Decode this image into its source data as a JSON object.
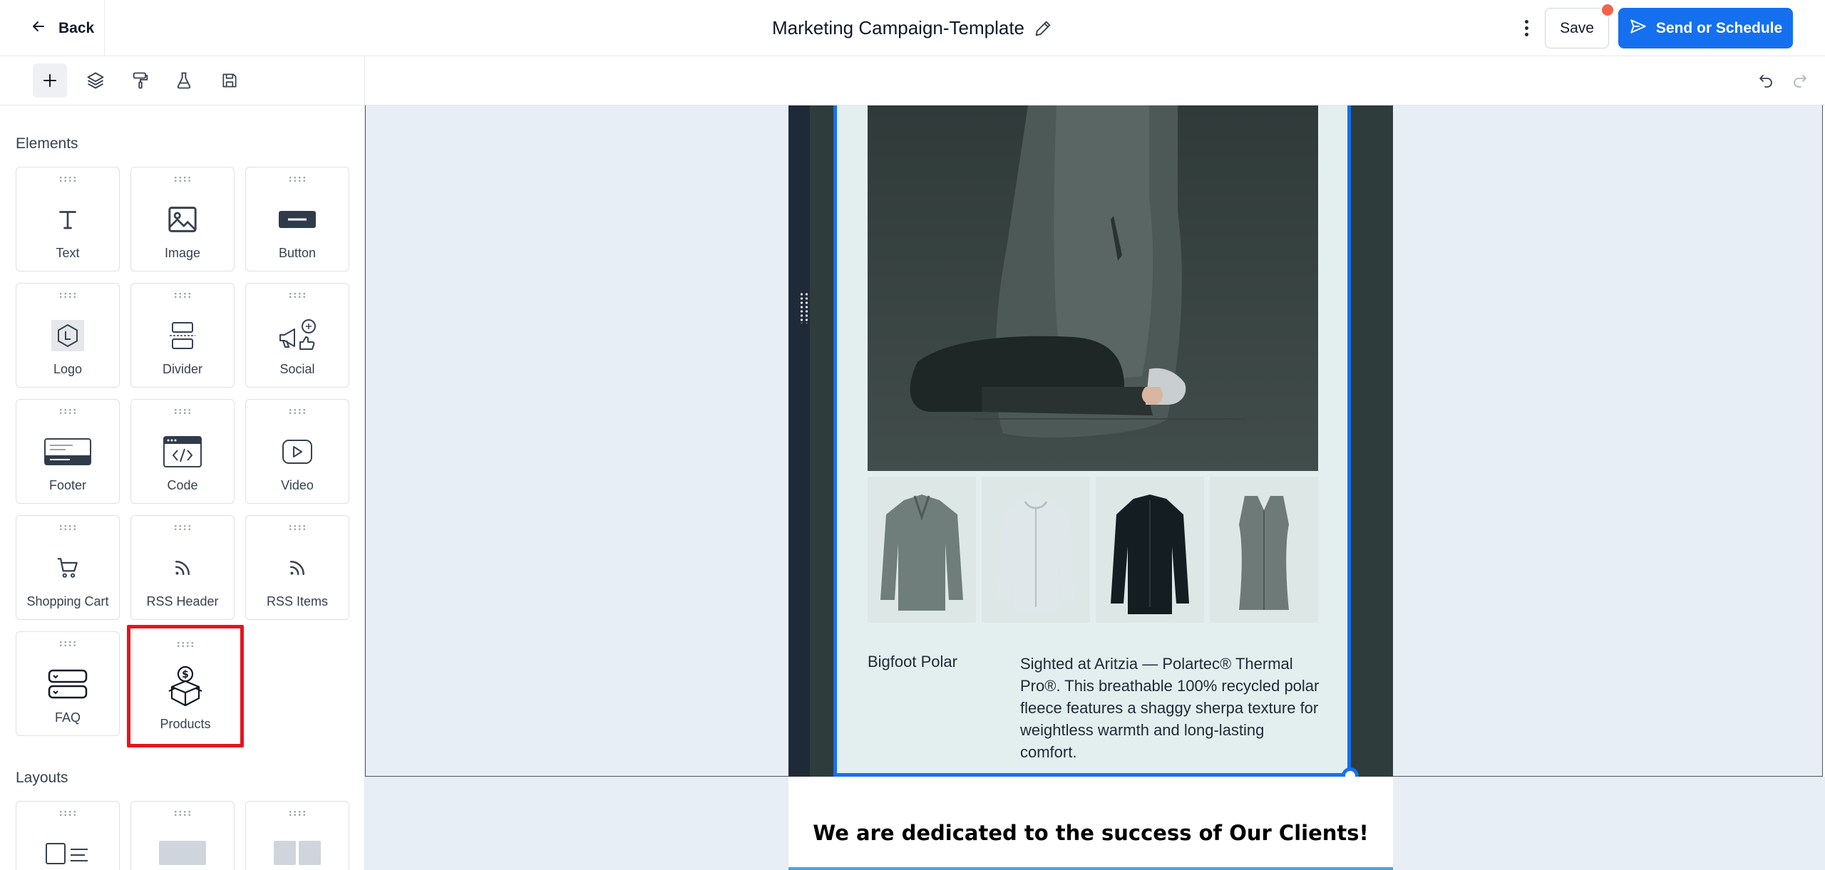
{
  "header": {
    "back_label": "Back",
    "title": "Marketing Campaign-Template",
    "save_label": "Save",
    "send_label": "Send or Schedule"
  },
  "toolbar": {
    "icons": [
      "add-icon",
      "layers-icon",
      "paint-roller-icon",
      "flask-icon",
      "save-icon"
    ],
    "right_icons": [
      "undo-icon",
      "redo-icon"
    ]
  },
  "sidebar": {
    "elements_title": "Elements",
    "elements": [
      {
        "label": "Text",
        "icon": "text-icon"
      },
      {
        "label": "Image",
        "icon": "image-icon"
      },
      {
        "label": "Button",
        "icon": "button-icon"
      },
      {
        "label": "Logo",
        "icon": "logo-icon"
      },
      {
        "label": "Divider",
        "icon": "divider-icon"
      },
      {
        "label": "Social",
        "icon": "social-icon"
      },
      {
        "label": "Footer",
        "icon": "footer-icon"
      },
      {
        "label": "Code",
        "icon": "code-icon"
      },
      {
        "label": "Video",
        "icon": "video-icon"
      },
      {
        "label": "Shopping Cart",
        "icon": "cart-icon"
      },
      {
        "label": "RSS Header",
        "icon": "rss-icon"
      },
      {
        "label": "RSS Items",
        "icon": "rss-icon"
      },
      {
        "label": "FAQ",
        "icon": "faq-icon"
      },
      {
        "label": "Products",
        "icon": "products-icon"
      }
    ],
    "layouts_title": "Layouts"
  },
  "email": {
    "product_name": "Bigfoot Polar",
    "product_description": "Sighted at Aritzia — Polartec® Thermal Pro®.  This breathable 100% recycled polar fleece features a shaggy sherpa texture for weightless warmth and long-lasting comfort.",
    "tagline": "We are dedicated to the success of Our Clients!"
  },
  "colors": {
    "accent": "#1570ef",
    "highlight": "#e5141c",
    "notification": "#f2634a",
    "canvas_bg": "#e8eef5"
  }
}
